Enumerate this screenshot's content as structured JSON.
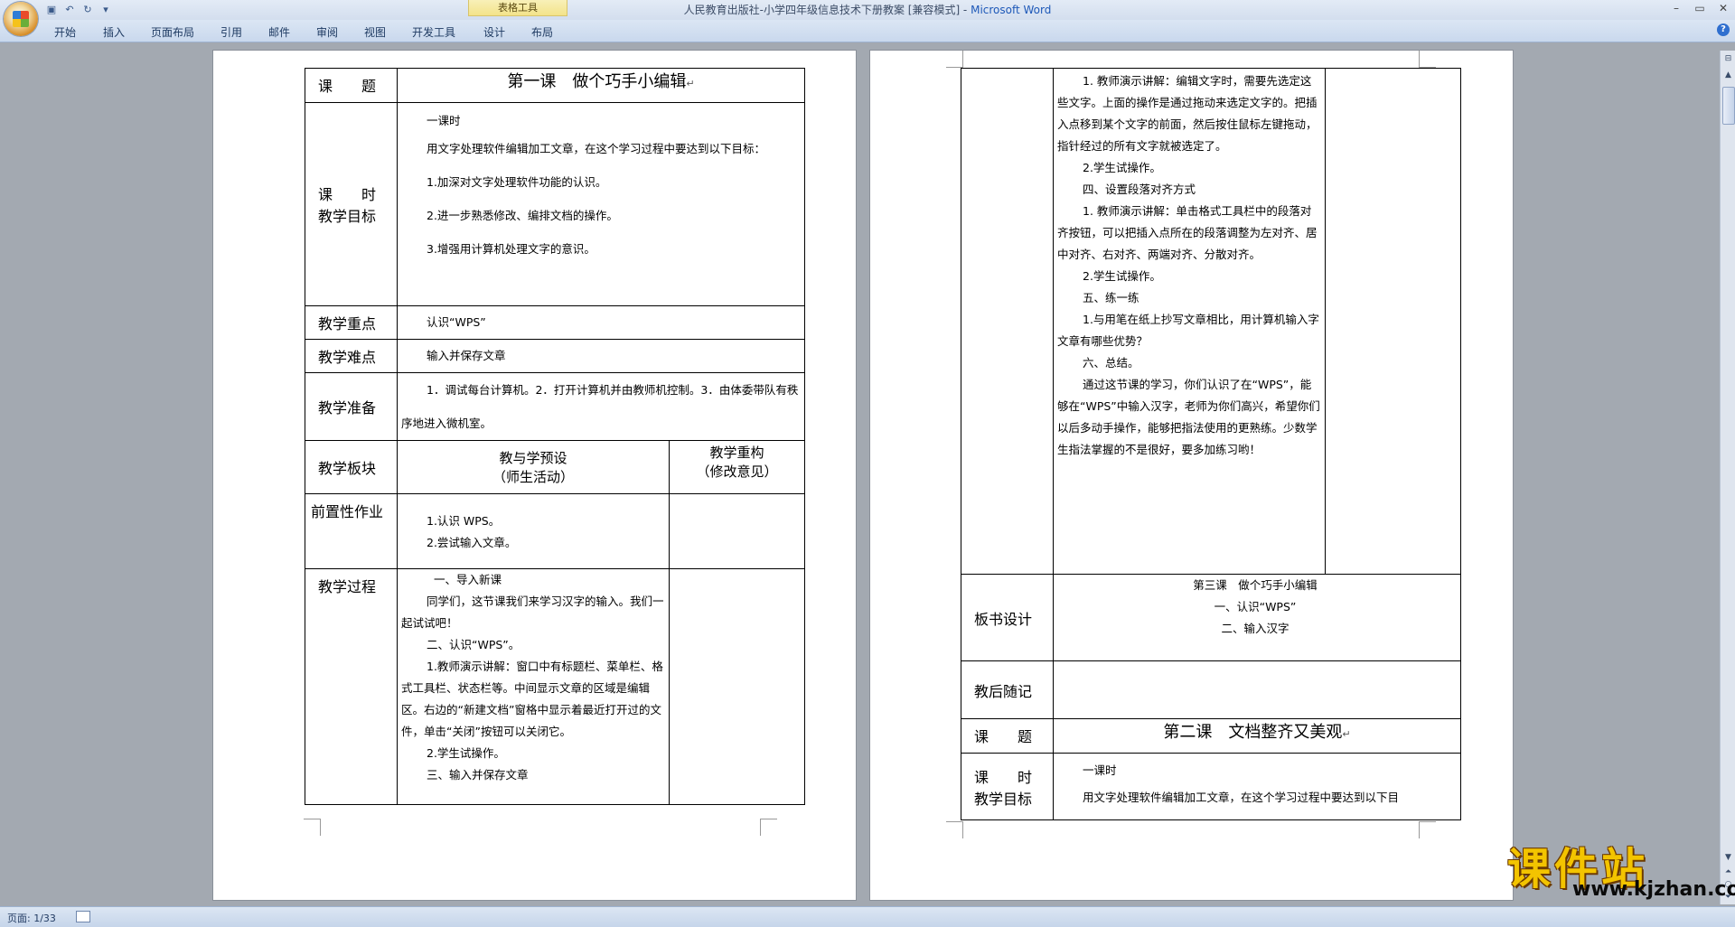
{
  "window": {
    "title": "人民教育出版社-小学四年级信息技术下册教案 [兼容模式] - ",
    "app_name": "Microsoft Word",
    "contextual_group": "表格工具"
  },
  "ribbon": {
    "tabs": [
      "开始",
      "插入",
      "页面布局",
      "引用",
      "邮件",
      "审阅",
      "视图",
      "开发工具",
      "设计",
      "布局"
    ]
  },
  "status": {
    "page": "页面: 1/33"
  },
  "page1": {
    "title_label": "课　　题",
    "title": "第一课　做个巧手小编辑",
    "time_goal_label1": "课　　时",
    "time_goal_label2": "教学目标",
    "goal_lines": [
      "一课时",
      "用文字处理软件编辑加工文章，在这个学习过程中要达到以下目标：",
      "1.加深对文字处理软件功能的认识。",
      "2.进一步熟悉修改、编排文档的操作。",
      "3.增强用计算机处理文字的意识。"
    ],
    "focus_label": "教学重点",
    "focus": "认识“WPS”",
    "difficulty_label": "教学难点",
    "difficulty": "输入并保存文章",
    "prep_label": "教学准备",
    "prep": "1．调试每台计算机。2．打开计算机并由教师机控制。3．由体委带队有秩序地进入微机室。",
    "block_label": "教学板块",
    "preset_header1": "教与学预设",
    "preset_header2": "（师生活动）",
    "rebuild_header1": "教学重构",
    "rebuild_header2": "（修改意见）",
    "pre_label": "前置性作业",
    "pre_lines": [
      "1.认识 WPS。",
      "2.尝试输入文章。"
    ],
    "process_label": "教学过程",
    "process_lines": [
      "一、导入新课",
      "同学们，这节课我们来学习汉字的输入。我们一起试试吧！",
      "二、认识“WPS”。",
      "1.教师演示讲解：窗口中有标题栏、菜单栏、格式工具栏、状态栏等。中间显示文章的区域是编辑区。右边的“新建文档”窗格中显示着最近打开过的文件，单击“关闭”按钮可以关闭它。",
      "2.学生试操作。",
      "三、输入并保存文章"
    ]
  },
  "page2": {
    "process_lines": [
      "1. 教师演示讲解：编辑文字时，需要先选定这些文字。上面的操作是通过拖动来选定文字的。把插入点移到某个文字的前面，然后按住鼠标左键拖动，指针经过的所有文字就被选定了。",
      "2.学生试操作。",
      "四、设置段落对齐方式",
      "1. 教师演示讲解：单击格式工具栏中的段落对齐按钮，可以把插入点所在的段落调整为左对齐、居中对齐、右对齐、两端对齐、分散对齐。",
      "2.学生试操作。",
      "五、练一练",
      "1.与用笔在纸上抄写文章相比，用计算机输入字文章有哪些优势？",
      "六、总结。",
      "通过这节课的学习，你们认识了在“WPS”，能够在“WPS”中输入汉字，老师为你们高兴，希望你们以后多动手操作，能够把指法使用的更熟练。少数学生指法掌握的不是很好，要多加练习哟！"
    ],
    "board_label": "板书设计",
    "board_lines": [
      "第三课　做个巧手小编辑",
      "一、认识“WPS”",
      "二、输入汉字"
    ],
    "notes_label": "教后随记",
    "title_label": "课　　题",
    "title": "第二课　文档整齐又美观",
    "time_goal_label1": "课　　时",
    "time_goal_label2": "教学目标",
    "goal_lines": [
      "一课时",
      "用文字处理软件编辑加工文章，在这个学习过程中要达到以下目"
    ]
  },
  "watermark": {
    "logo": "课件站",
    "url": "www.kjzhan.com"
  }
}
